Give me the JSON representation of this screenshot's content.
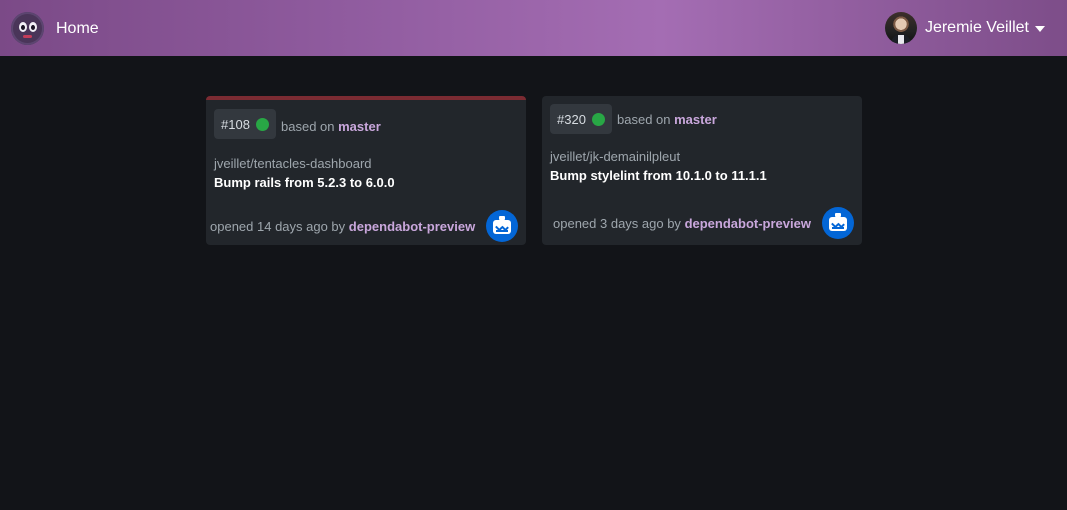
{
  "nav": {
    "home_label": "Home",
    "user_name": "Jeremie Veillet"
  },
  "cards": [
    {
      "number": "#108",
      "status_color": "#28a745",
      "based_on_prefix": "based on",
      "branch": "master",
      "repo": "jveillet/tentacles-dashboard",
      "title": "Bump rails from 5.2.3 to 6.0.0",
      "opened_prefix": "opened 14 days ago by",
      "author": "dependabot-preview"
    },
    {
      "number": "#320",
      "status_color": "#28a745",
      "based_on_prefix": "based on",
      "branch": "master",
      "repo": "jveillet/jk-demainilpleut",
      "title": "Bump stylelint from 10.1.0 to 11.1.1",
      "opened_prefix": "opened 3 days ago by",
      "author": "dependabot-preview"
    }
  ],
  "colors": {
    "accent": "#a46db3",
    "background": "#121418",
    "card": "#22262b",
    "link": "#c9a7dc"
  }
}
